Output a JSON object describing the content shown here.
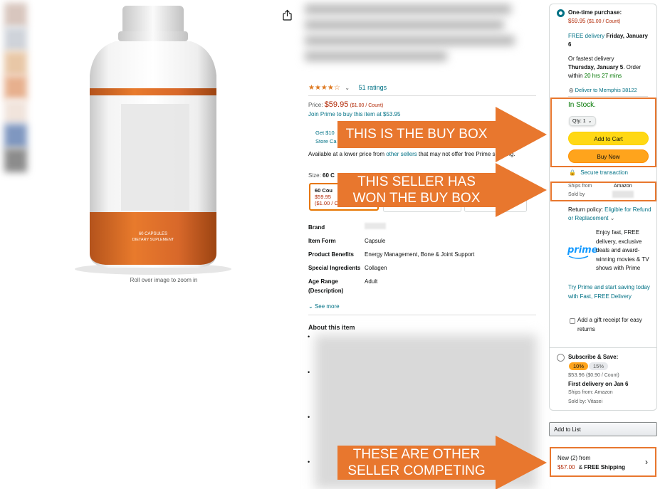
{
  "left": {
    "zoom_hint": "Roll over image to zoom in",
    "product_label_line1": "60 CAPSULES",
    "product_label_line2": "DIETARY SUPLEMENT"
  },
  "center": {
    "ratings_text": "51 ratings",
    "price_label": "Price:",
    "price": "$59.95",
    "price_unit": "($1.00 / Count)",
    "prime_text_1": "Join Prime",
    "prime_text_2": "to buy this item at $53.95",
    "coupon_line1": "Get $10",
    "coupon_line2": "Store Ca",
    "avail_text_1": "Available at a lower price from ",
    "avail_link": "other sellers",
    "avail_text_2": " that may not offer free Prime shipping.",
    "size_label": "Size: ",
    "size_value": "60 C",
    "size_option": {
      "label": "60 Cou",
      "price": "$59.95",
      "unit": "($1.00 / C"
    },
    "specs": [
      {
        "key": "Brand",
        "value": ""
      },
      {
        "key": "Item Form",
        "value": "Capsule"
      },
      {
        "key": "Product Benefits",
        "value": "Energy Management, Bone & Joint Support"
      },
      {
        "key": "Special Ingredients",
        "value": "Collagen"
      },
      {
        "key": "Age Range (Description)",
        "value": "Adult"
      }
    ],
    "see_more": "See more",
    "about_title": "About this item"
  },
  "buy": {
    "one_time": "One-time purchase:",
    "price_line": "$59.95",
    "price_unit": "($1.00 / Count)",
    "free_delivery": "FREE delivery",
    "delivery_day": "Friday, January 6",
    "fastest_text": "Or fastest delivery",
    "fastest_day": "Thursday, January 5",
    "order_within": ". Order within ",
    "countdown": "20 hrs 27 mins",
    "deliver_to": "Deliver to Memphis 38122",
    "in_stock": "In Stock.",
    "qty": "Qty: 1",
    "add_to_cart": "Add to Cart",
    "buy_now": "Buy Now",
    "secure": "Secure transaction",
    "ships_from_label": "Ships from",
    "ships_from_value": "Amazon",
    "sold_by_label": "Sold by",
    "return_label": "Return policy: ",
    "return_link": "Eligible for Refund or Replacement",
    "prime_logo": "prime",
    "prime_desc": "Enjoy fast, FREE delivery, exclusive deals and award-winning movies & TV shows with Prime",
    "prime_try": "Try Prime and start saving today with Fast, FREE Delivery",
    "gift": "Add a gift receipt for easy returns",
    "subscribe": "Subscribe & Save:",
    "pct10": "10%",
    "pct15": "15%",
    "sub_price": "$53.96",
    "sub_unit": "($0.90 / Count)",
    "first_delivery": "First delivery on Jan 6",
    "sub_ships": "Ships from: Amazon",
    "sub_sold": "Sold by: Vitasei",
    "add_to_list": "Add to List",
    "new_from": "New (2) from",
    "new_price": "$57.00",
    "free_shipping": "FREE Shipping"
  },
  "annotations": {
    "buy_box": "THIS IS THE BUY BOX",
    "seller_line1": "THIS SELLER HAS",
    "seller_line2": "WON THE BUY BOX",
    "other_line1": "THESE ARE OTHER",
    "other_line2": "SELLER COMPETING"
  },
  "colors": {
    "annotation": "#e8772e",
    "link": "#007185",
    "price": "#b12704",
    "stock": "#007600",
    "cart": "#ffd814",
    "buy_now": "#ffa41c"
  }
}
